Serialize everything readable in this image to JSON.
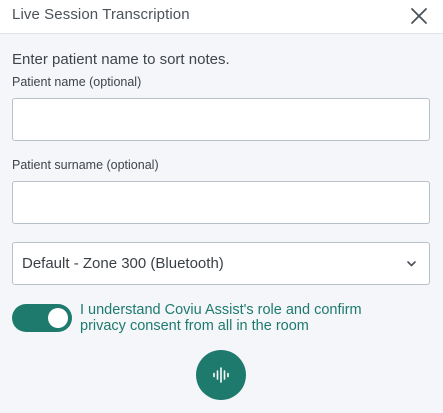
{
  "window": {
    "title": "Live Session Transcription",
    "close_icon": "close-icon"
  },
  "form": {
    "instruction": "Enter patient name to sort notes.",
    "first_name": {
      "label": "Patient name (optional)",
      "value": "",
      "placeholder": ""
    },
    "last_name": {
      "label": "Patient surname (optional)",
      "value": "",
      "placeholder": ""
    },
    "microphone": {
      "selected": "Default - Zone 300 (Bluetooth)",
      "icon": "chevron-down-icon"
    },
    "consent": {
      "checked": true,
      "text": "I understand Coviu Assist's role and confirm privacy consent from all in the room"
    },
    "record": {
      "icon": "audio-waveform-icon"
    }
  },
  "colors": {
    "accent": "#1f7a6e",
    "background": "#f4f6f9",
    "header": "#ffffff",
    "border": "#b8c0c8"
  }
}
